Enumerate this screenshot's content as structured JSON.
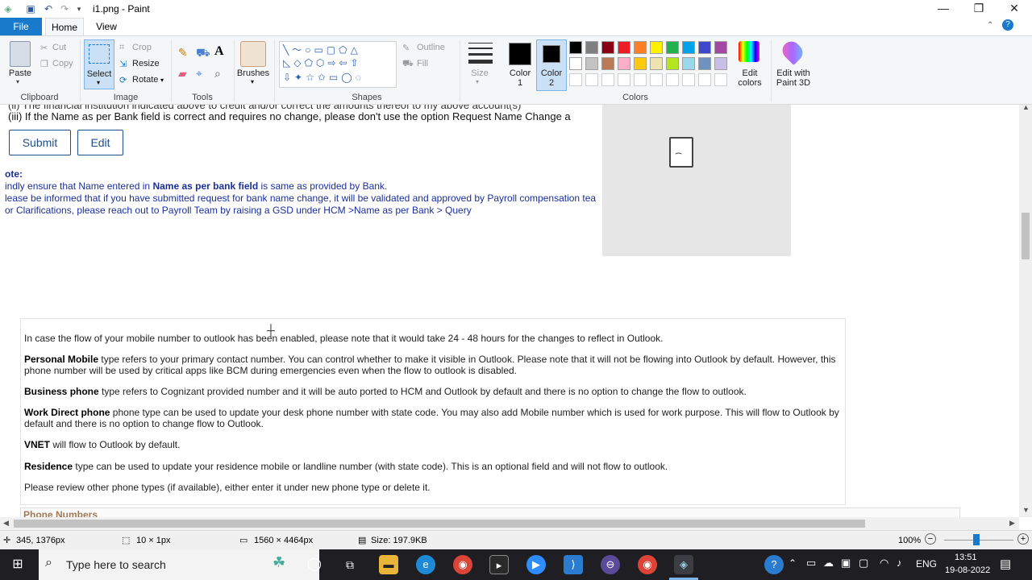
{
  "window": {
    "title": "i1.png - Paint",
    "minimize": "—",
    "restore": "❐",
    "close": "✕"
  },
  "tabs": {
    "file": "File",
    "home": "Home",
    "view": "View"
  },
  "ribbon": {
    "clipboard": {
      "label": "Clipboard",
      "paste": "Paste",
      "cut": "Cut",
      "copy": "Copy"
    },
    "image": {
      "label": "Image",
      "select": "Select",
      "crop": "Crop",
      "resize": "Resize",
      "rotate": "Rotate"
    },
    "tools": {
      "label": "Tools"
    },
    "brushes": "Brushes",
    "shapes": {
      "label": "Shapes",
      "outline": "Outline",
      "fill": "Fill"
    },
    "size": "Size",
    "color1": "Color\n1",
    "color1_a": "Color",
    "color1_b": "1",
    "color2_a": "Color",
    "color2_b": "2",
    "colors": {
      "label": "Colors",
      "edit": "Edit",
      "edit2": "colors"
    },
    "paint3d_a": "Edit with",
    "paint3d_b": "Paint 3D"
  },
  "palette": [
    "#000000",
    "#7f7f7f",
    "#880015",
    "#ed1c24",
    "#ff7f27",
    "#fff200",
    "#22b14c",
    "#00a2e8",
    "#3f48cc",
    "#a349a4",
    "#ffffff",
    "#c3c3c3",
    "#b97a57",
    "#ffaec9",
    "#ffc90e",
    "#efe4b0",
    "#b5e61d",
    "#99d9ea",
    "#7092be",
    "#c8bfe7"
  ],
  "document": {
    "line_ii": "(ii) The financial institution indicated above to credit and/or correct the amounts thereof to my above account(s)",
    "line_iii": "(iii) If the Name as per Bank field is correct and requires no change, please don't use the option Request Name Change a",
    "submit": "Submit",
    "edit": "Edit",
    "note_title": "ote:",
    "note1_a": "indly ensure that Name entered in ",
    "note1_b": "Name as per bank field",
    "note1_c": " is same as provided by Bank.",
    "note2": "lease be informed that if you have submitted request for bank name change, it will be validated and approved by Payroll compensation tea",
    "note3": "or Clarifications, please reach out to Payroll Team by raising a GSD under HCM >Name as per Bank > Query",
    "p1": "In case the flow of your mobile number to outlook has been enabled, please note that it would take 24 - 48 hours for the changes to reflect in Outlook.",
    "p2_b": "Personal Mobile",
    "p2": " type refers to your primary contact number. You can control whether to make it visible in Outlook. Please note that it will not be flowing into Outlook by default. However, this phone number will be used by critical apps like BCM during emergencies even when the flow to outlook is disabled.",
    "p3_b": "Business phone",
    "p3": " type refers to Cognizant provided number and it will be auto ported to HCM and Outlook by default and there is no option to change the flow to outlook.",
    "p4_b": "Work Direct phone",
    "p4": " phone type can be used to update your desk phone number with state code. You may also add Mobile number which is used for work purpose. This will flow to Outlook by default and there is no option to change flow to Outlook.",
    "p5_b": "VNET",
    "p5": " will flow to Outlook by default.",
    "p6_b": "Residence",
    "p6": " type can be used to update your residence mobile or landline number (with state code). This is an optional field and will not flow to outlook.",
    "p7": "Please review other phone types (if available), either enter it under new phone type or delete it.",
    "phone_numbers": "Phone Numbers"
  },
  "status": {
    "cursor": "345, 1376px",
    "selection": "10 × 1px",
    "dimensions": "1560 × 4464px",
    "size": "Size: 197.9KB",
    "zoom": "100%"
  },
  "taskbar": {
    "search_placeholder": "Type here to search",
    "lang": "ENG",
    "time": "13:51",
    "date": "19-08-2022"
  }
}
